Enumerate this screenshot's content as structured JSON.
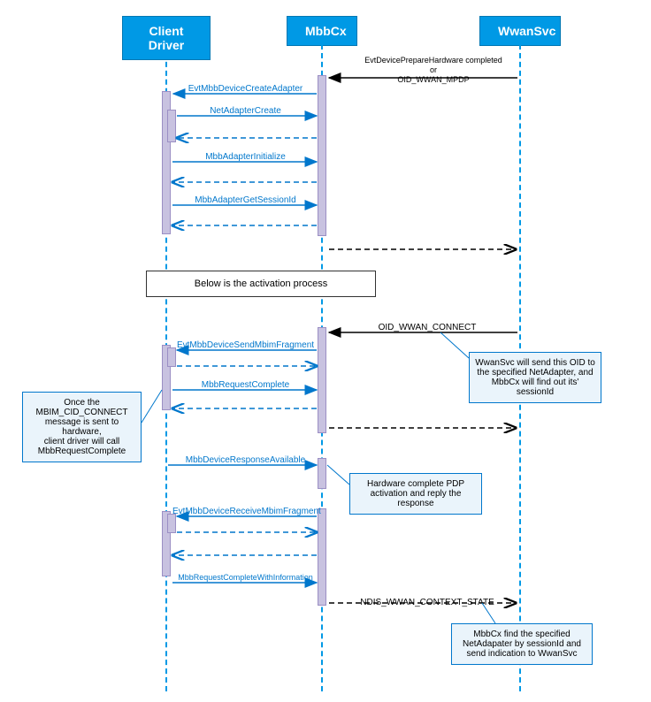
{
  "participants": {
    "client": "Client Driver",
    "mbbcx": "MbbCx",
    "wwan": "WwanSvc"
  },
  "top_note": "EvtDevicePrepareHardware completed\nor\nOID_WWAN_MPDP",
  "messages": {
    "m1": "EvtMbbDeviceCreateAdapter",
    "m2": "NetAdapterCreate",
    "m3": "MbbAdapterInitialize",
    "m4": "MbbAdapterGetSessionId",
    "m5": "OID_WWAN_CONNECT",
    "m6": "EvtMbbDeviceSendMbimFragment",
    "m7": "MbbRequestComplete",
    "m8": "MbbDeviceResponseAvailable",
    "m9": "EvtMbbDeviceReceiveMbimFragment",
    "m10": "MbbRequestCompleteWithInformation",
    "m11": "NDIS_WWAN_CONTEXT_STATE"
  },
  "divider": "Below is the activation process",
  "callouts": {
    "c1": "Once the MBIM_CID_CONNECT message is sent to hardware,\nclient driver will call MbbRequestComplete",
    "c2": "WwanSvc will send this OID to the specified NetAdapter, and MbbCx will find out its' sessionId",
    "c3": "Hardware complete PDP activation and reply the response",
    "c4": "MbbCx find the specified NetAdapater by sessionId and send indication to WwanSvc"
  },
  "chart_data": {
    "type": "sequence_diagram",
    "participants": [
      "Client Driver",
      "MbbCx",
      "WwanSvc"
    ],
    "interactions": [
      {
        "from": "WwanSvc",
        "to": "MbbCx",
        "label": "EvtDevicePrepareHardware completed or OID_WWAN_MPDP",
        "style": "solid"
      },
      {
        "from": "MbbCx",
        "to": "Client Driver",
        "label": "EvtMbbDeviceCreateAdapter",
        "style": "solid"
      },
      {
        "from": "Client Driver",
        "to": "MbbCx",
        "label": "NetAdapterCreate",
        "style": "solid"
      },
      {
        "from": "MbbCx",
        "to": "Client Driver",
        "label": "",
        "style": "dashed_return"
      },
      {
        "from": "Client Driver",
        "to": "MbbCx",
        "label": "MbbAdapterInitialize",
        "style": "solid"
      },
      {
        "from": "MbbCx",
        "to": "Client Driver",
        "label": "",
        "style": "dashed_return"
      },
      {
        "from": "Client Driver",
        "to": "MbbCx",
        "label": "MbbAdapterGetSessionId",
        "style": "solid"
      },
      {
        "from": "MbbCx",
        "to": "Client Driver",
        "label": "",
        "style": "dashed_return"
      },
      {
        "from": "MbbCx",
        "to": "WwanSvc",
        "label": "",
        "style": "dashed"
      },
      {
        "note": "Below is the activation process"
      },
      {
        "from": "WwanSvc",
        "to": "MbbCx",
        "label": "OID_WWAN_CONNECT",
        "style": "solid"
      },
      {
        "from": "MbbCx",
        "to": "Client Driver",
        "label": "EvtMbbDeviceSendMbimFragment",
        "style": "solid"
      },
      {
        "from": "Client Driver",
        "to": "MbbCx",
        "label": "",
        "style": "dashed_return"
      },
      {
        "from": "Client Driver",
        "to": "MbbCx",
        "label": "MbbRequestComplete",
        "style": "solid"
      },
      {
        "from": "MbbCx",
        "to": "Client Driver",
        "label": "",
        "style": "dashed_return"
      },
      {
        "from": "MbbCx",
        "to": "WwanSvc",
        "label": "",
        "style": "dashed"
      },
      {
        "from": "Client Driver",
        "to": "MbbCx",
        "label": "MbbDeviceResponseAvailable",
        "style": "solid"
      },
      {
        "from": "MbbCx",
        "to": "Client Driver",
        "label": "EvtMbbDeviceReceiveMbimFragment",
        "style": "solid"
      },
      {
        "from": "Client Driver",
        "to": "MbbCx",
        "label": "",
        "style": "dashed_return"
      },
      {
        "from": "MbbCx",
        "to": "Client Driver",
        "label": "",
        "style": "dashed_return"
      },
      {
        "from": "Client Driver",
        "to": "MbbCx",
        "label": "MbbRequestCompleteWithInformation",
        "style": "solid"
      },
      {
        "from": "MbbCx",
        "to": "WwanSvc",
        "label": "NDIS_WWAN_CONTEXT_STATE",
        "style": "dashed"
      }
    ]
  }
}
